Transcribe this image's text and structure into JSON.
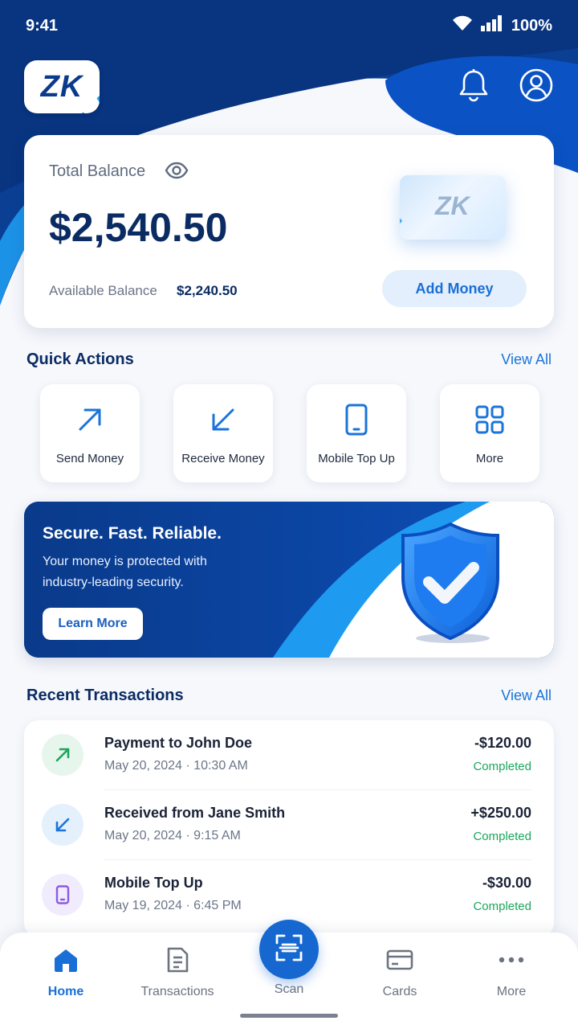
{
  "status_bar": {
    "time": "9:41",
    "battery": "100%"
  },
  "header": {
    "logo_text": "ZK"
  },
  "balance": {
    "label": "Total Balance",
    "amount": "$2,540.50",
    "available_label": "Available Balance",
    "available_value": "$2,240.50",
    "card_text": "ZK",
    "add_money_label": "Add Money"
  },
  "quick_actions": {
    "title": "Quick Actions",
    "view_all": "View All",
    "items": [
      {
        "label": "Send Money",
        "icon": "arrow-up-right-icon"
      },
      {
        "label": "Receive Money",
        "icon": "arrow-down-left-icon"
      },
      {
        "label": "Mobile Top Up",
        "icon": "phone-icon"
      },
      {
        "label": "More",
        "icon": "grid-icon"
      }
    ]
  },
  "promo": {
    "title": "Secure. Fast. Reliable.",
    "subtitle": "Your money is protected with industry-leading security.",
    "button_label": "Learn More"
  },
  "transactions": {
    "title": "Recent Transactions",
    "view_all": "View All",
    "items": [
      {
        "title": "Payment to John Doe",
        "date": "May 20, 2024 · 10:30 AM",
        "amount": "-$120.00",
        "status": "Completed",
        "icon": "arrow-up-right-icon"
      },
      {
        "title": "Received from Jane Smith",
        "date": "May 20, 2024 · 9:15 AM",
        "amount": "+$250.00",
        "status": "Completed",
        "icon": "arrow-down-left-icon"
      },
      {
        "title": "Mobile Top Up",
        "date": "May 19, 2024 · 6:45 PM",
        "amount": "-$30.00",
        "status": "Completed",
        "icon": "phone-icon"
      }
    ]
  },
  "bottom_nav": {
    "items": [
      {
        "label": "Home",
        "active": true
      },
      {
        "label": "Transactions",
        "active": false
      },
      {
        "label": "Scan",
        "active": false
      },
      {
        "label": "Cards",
        "active": false
      },
      {
        "label": "More",
        "active": false
      }
    ]
  },
  "colors": {
    "primary_dark": "#0b3a8c",
    "primary": "#1668d0",
    "accent_light": "#1e9bf0",
    "success": "#1aa65c"
  }
}
